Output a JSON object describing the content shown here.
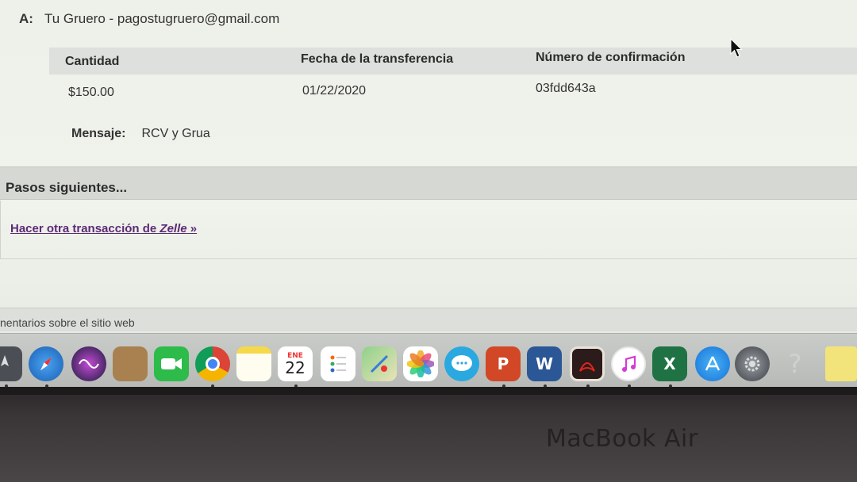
{
  "recipient": {
    "label": "A:",
    "value": "Tu Gruero - pagostugruero@gmail.com"
  },
  "table": {
    "headers": [
      "Cantidad",
      "Fecha de la transferencia",
      "Número de confirmación"
    ],
    "row": {
      "amount": "$150.00",
      "date": "01/22/2020",
      "confirmation": "03fdd643a"
    }
  },
  "message": {
    "label": "Mensaje:",
    "value": "RCV y Grua"
  },
  "next_steps": {
    "title": "Pasos siguientes...",
    "link_prefix": "Hacer otra transacción de ",
    "link_brand": "Zelle",
    "link_suffix": " »"
  },
  "footer": {
    "text": "nentarios sobre el sitio web"
  },
  "dock": {
    "calendar_month": "ENE",
    "calendar_day": "22",
    "items": [
      "launchpad-icon",
      "safari-icon",
      "siri-icon",
      "notes-brown-icon",
      "facetime-icon",
      "chrome-icon",
      "notes-icon",
      "calendar-icon",
      "reminders-icon",
      "maps-icon",
      "photos-icon",
      "messages-icon",
      "powerpoint-icon",
      "word-icon",
      "acrobat-icon",
      "itunes-icon",
      "excel-icon",
      "app-store-icon",
      "system-preferences-icon",
      "help-icon",
      "stickies-icon"
    ]
  },
  "device": {
    "label": "MacBook Air"
  }
}
